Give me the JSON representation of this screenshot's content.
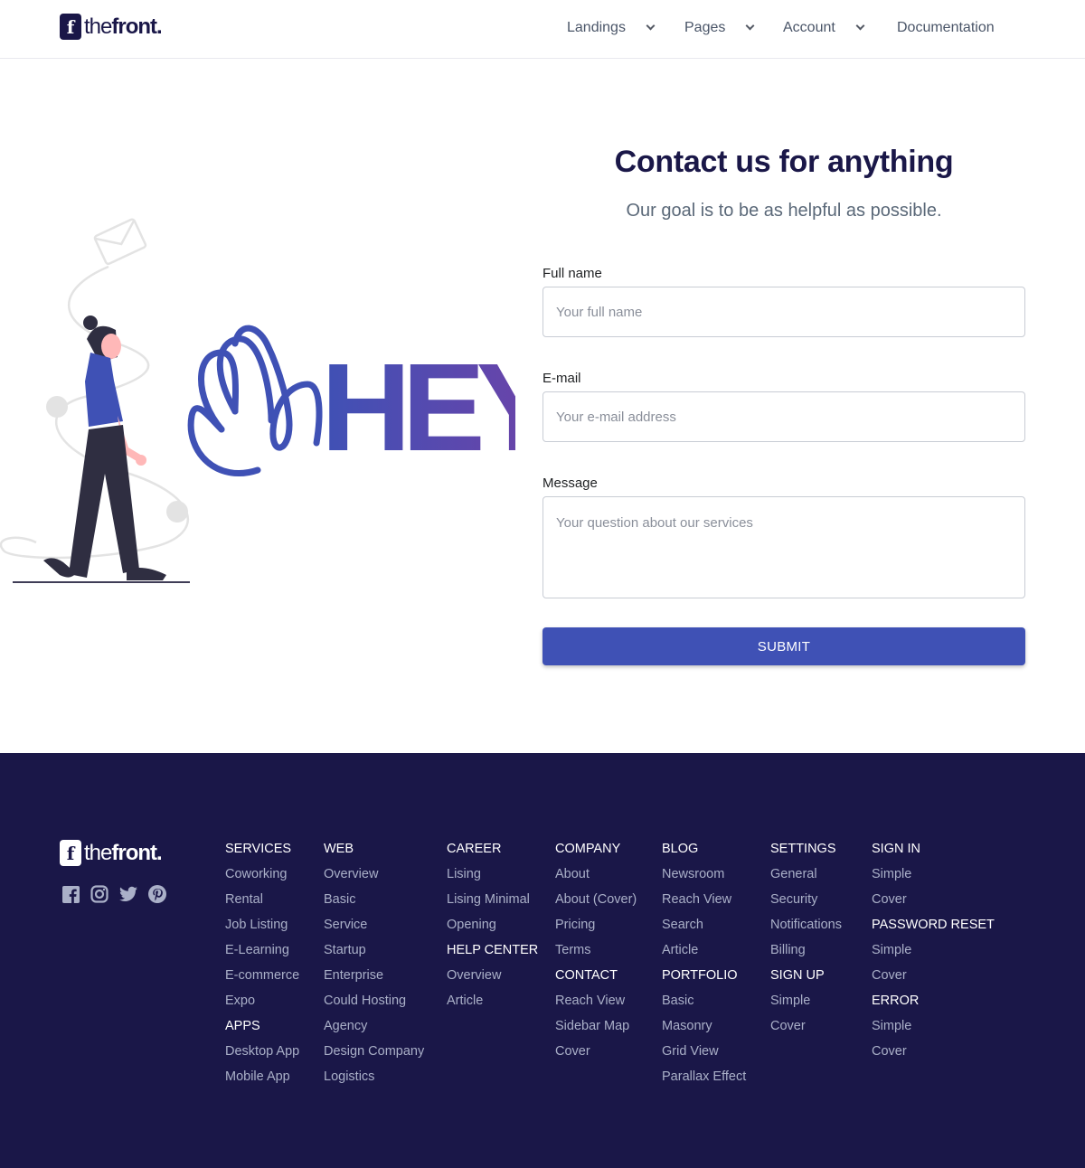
{
  "brand": {
    "logo_letter": "f",
    "name_light": "the",
    "name_bold": "front."
  },
  "nav": {
    "items": [
      {
        "label": "Landings",
        "has_dropdown": true
      },
      {
        "label": "Pages",
        "has_dropdown": true
      },
      {
        "label": "Account",
        "has_dropdown": true
      },
      {
        "label": "Documentation",
        "has_dropdown": false
      }
    ]
  },
  "hero": {
    "title": "Contact us for anything",
    "subtitle": "Our goal is to be as helpful as possible."
  },
  "form": {
    "full_name": {
      "label": "Full name",
      "placeholder": "Your full name",
      "value": ""
    },
    "email": {
      "label": "E-mail",
      "placeholder": "Your e-mail address",
      "value": ""
    },
    "message": {
      "label": "Message",
      "placeholder": "Your question about our services",
      "value": ""
    },
    "submit_label": "SUBMIT"
  },
  "illustration": {
    "text": "HEY"
  },
  "footer": {
    "socials": [
      "facebook-icon",
      "instagram-icon",
      "twitter-icon",
      "pinterest-icon"
    ],
    "columns": [
      {
        "items": [
          {
            "text": "SERVICES",
            "head": true
          },
          {
            "text": "Coworking"
          },
          {
            "text": "Rental"
          },
          {
            "text": "Job Listing"
          },
          {
            "text": "E-Learning"
          },
          {
            "text": "E-commerce"
          },
          {
            "text": "Expo"
          },
          {
            "text": "APPS",
            "head": true
          },
          {
            "text": "Desktop App"
          },
          {
            "text": "Mobile App"
          }
        ]
      },
      {
        "items": [
          {
            "text": "WEB",
            "head": true
          },
          {
            "text": "Overview"
          },
          {
            "text": "Basic"
          },
          {
            "text": "Service"
          },
          {
            "text": "Startup"
          },
          {
            "text": "Enterprise"
          },
          {
            "text": "Could Hosting"
          },
          {
            "text": "Agency"
          },
          {
            "text": "Design Company"
          },
          {
            "text": "Logistics"
          }
        ]
      },
      {
        "items": [
          {
            "text": "CAREER",
            "head": true
          },
          {
            "text": "Lising"
          },
          {
            "text": "Lising Minimal"
          },
          {
            "text": "Opening"
          },
          {
            "text": "HELP CENTER",
            "head": true
          },
          {
            "text": "Overview"
          },
          {
            "text": "Article"
          }
        ]
      },
      {
        "items": [
          {
            "text": "COMPANY",
            "head": true
          },
          {
            "text": "About"
          },
          {
            "text": "About (Cover)"
          },
          {
            "text": "Pricing"
          },
          {
            "text": "Terms"
          },
          {
            "text": "CONTACT",
            "head": true
          },
          {
            "text": "Reach View"
          },
          {
            "text": "Sidebar Map"
          },
          {
            "text": "Cover"
          }
        ]
      },
      {
        "items": [
          {
            "text": "BLOG",
            "head": true
          },
          {
            "text": "Newsroom"
          },
          {
            "text": "Reach View"
          },
          {
            "text": "Search"
          },
          {
            "text": "Article"
          },
          {
            "text": "PORTFOLIO",
            "head": true
          },
          {
            "text": "Basic"
          },
          {
            "text": "Masonry"
          },
          {
            "text": "Grid View"
          },
          {
            "text": "Parallax Effect"
          }
        ]
      },
      {
        "items": [
          {
            "text": "SETTINGS",
            "head": true
          },
          {
            "text": "General"
          },
          {
            "text": "Security"
          },
          {
            "text": "Notifications"
          },
          {
            "text": "Billing"
          },
          {
            "text": "SIGN UP",
            "head": true
          },
          {
            "text": "Simple"
          },
          {
            "text": "Cover"
          }
        ]
      },
      {
        "items": [
          {
            "text": "SIGN IN",
            "head": true
          },
          {
            "text": "Simple"
          },
          {
            "text": "Cover"
          },
          {
            "text": "PASSWORD RESET",
            "head": true
          },
          {
            "text": "Simple"
          },
          {
            "text": "Cover"
          },
          {
            "text": "ERROR",
            "head": true
          },
          {
            "text": "Simple"
          },
          {
            "text": "Cover"
          }
        ]
      }
    ]
  },
  "colors": {
    "primary": "#3f51b5",
    "footer_bg": "#1a1748",
    "title": "#1a1748"
  }
}
